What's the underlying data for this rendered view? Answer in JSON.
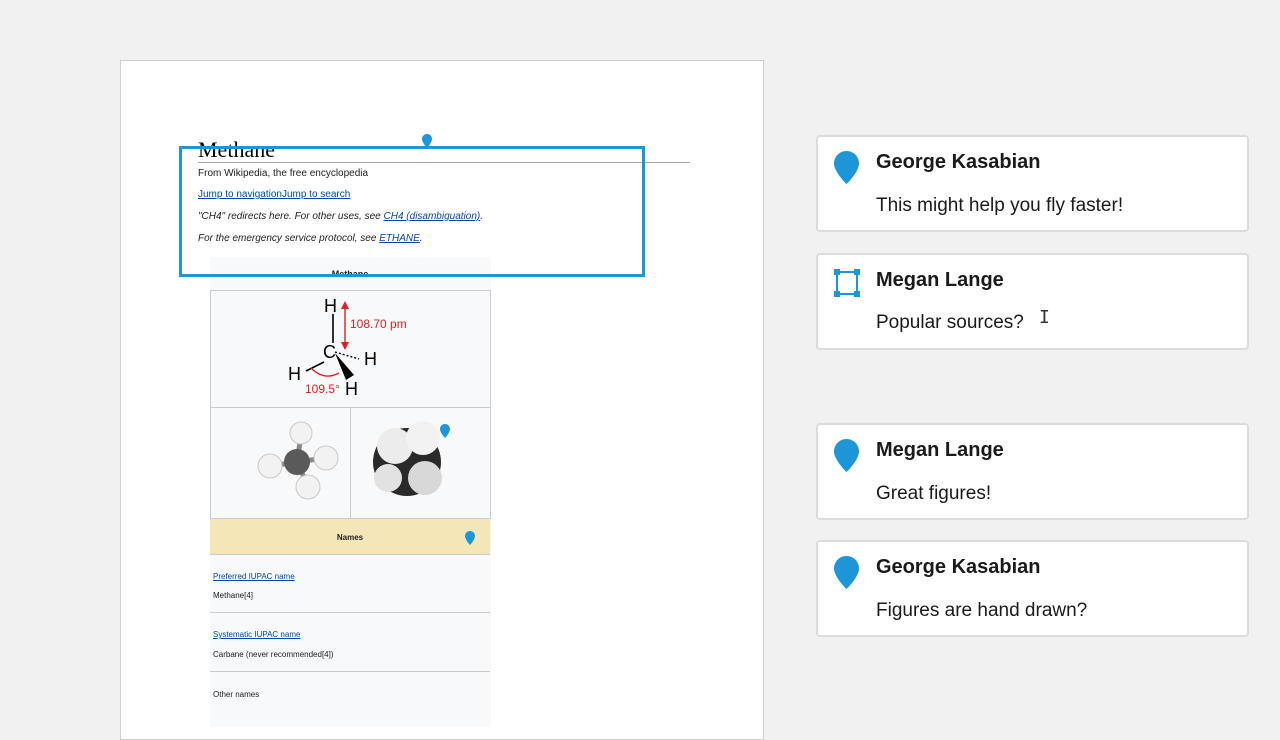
{
  "document": {
    "title": "Methane",
    "subtitle": "From Wikipedia, the free encyclopedia",
    "jump_links": "Jump to navigationJump to search",
    "redirect_text": "\"CH4\" redirects here. For other uses, see ",
    "redirect_link": "CH4 (disambiguation)",
    "redirect_end": ".",
    "protocol_text": "For the emergency service protocol, see ",
    "protocol_link": "ETHANE",
    "protocol_end": ".",
    "infobox": {
      "caption": "Methane",
      "diagram": {
        "bond_length": "108.70 pm",
        "bond_angle": "109.5°",
        "carbon": "C",
        "hydrogen": "H"
      },
      "names_header": "Names",
      "rows": [
        {
          "label": "Preferred IUPAC name",
          "value": "Methane[4]"
        },
        {
          "label": "Systematic IUPAC name",
          "value": "Carbane (never recommended[4])"
        },
        {
          "label": "",
          "value": "Other names"
        }
      ]
    }
  },
  "comments": [
    {
      "author": "George Kasabian",
      "text": "This might help you fly faster!",
      "icon": "pin-icon"
    },
    {
      "author": "Megan Lange",
      "text": "Popular sources?",
      "icon": "region-select-icon"
    },
    {
      "author": "Megan Lange",
      "text": "Great figures!",
      "icon": "pin-icon"
    },
    {
      "author": "George Kasabian",
      "text": "Figures are hand drawn?",
      "icon": "pin-icon"
    }
  ],
  "colors": {
    "accent": "#1c96d6",
    "link": "#0645ad",
    "bond_annotation": "#e02020",
    "names_header_bg": "#f5e6b8"
  }
}
